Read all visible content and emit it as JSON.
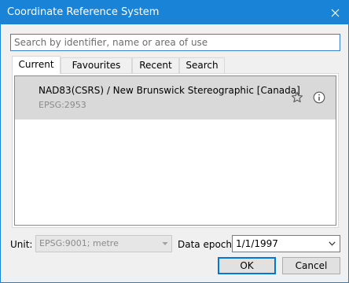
{
  "window": {
    "title": "Coordinate Reference System"
  },
  "search": {
    "placeholder": "Search by identifier, name or area of use",
    "value": ""
  },
  "tabs": [
    {
      "label": "Current",
      "active": true
    },
    {
      "label": "Favourites",
      "active": false
    },
    {
      "label": "Recent",
      "active": false
    },
    {
      "label": "Search",
      "active": false
    }
  ],
  "list": {
    "items": [
      {
        "name": "NAD83(CSRS) / New Brunswick Stereographic [Canada]",
        "code": "EPSG:2953",
        "selected": true
      }
    ]
  },
  "unit": {
    "label": "Unit:",
    "value": "EPSG:9001; metre",
    "enabled": false
  },
  "epoch": {
    "label": "Data epoch:",
    "value": "1/1/1997"
  },
  "buttons": {
    "ok": "OK",
    "cancel": "Cancel"
  },
  "icons": {
    "close": "close-icon",
    "star": "star-icon",
    "info": "info-icon"
  },
  "colors": {
    "titlebar": "#1883d7",
    "selected_row": "#d9d9d9",
    "accent": "#0078d7"
  }
}
